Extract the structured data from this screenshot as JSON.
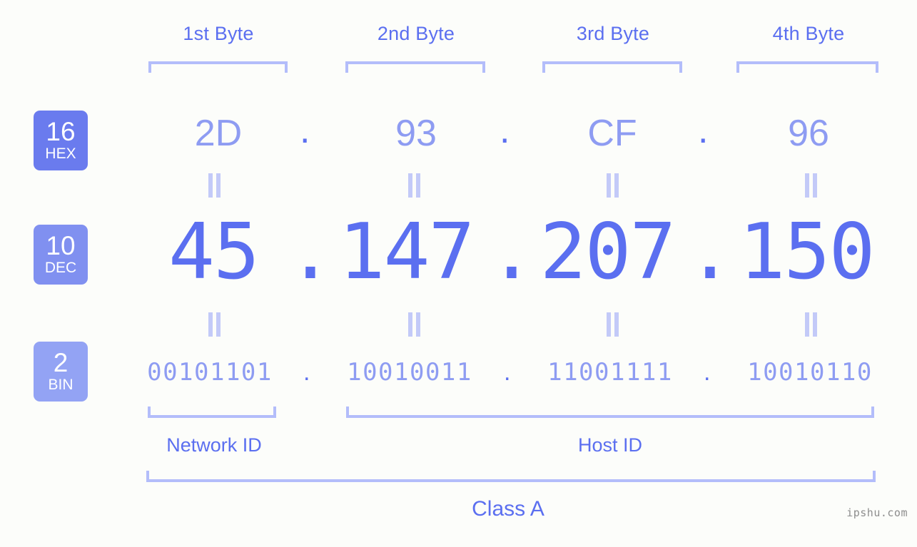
{
  "meta": {
    "background_color": "#fcfdfa",
    "accent_color": "#5b6ff0",
    "accent_light_color": "#8e9cf2",
    "bracket_color": "#b3bdfa",
    "watermark": "ipshu.com"
  },
  "byte_headers": [
    {
      "label": "1st Byte"
    },
    {
      "label": "2nd Byte"
    },
    {
      "label": "3rd Byte"
    },
    {
      "label": "4th Byte"
    }
  ],
  "bases": [
    {
      "number": "16",
      "unit": "HEX",
      "color": "#6a7bee"
    },
    {
      "number": "10",
      "unit": "DEC",
      "color": "#8090f0"
    },
    {
      "number": "2",
      "unit": "BIN",
      "color": "#93a3f4"
    }
  ],
  "rows": {
    "hex": {
      "name": "HEX",
      "values": [
        "2D",
        "93",
        "CF",
        "96"
      ],
      "separator": "."
    },
    "dec": {
      "name": "DEC",
      "values": [
        "45",
        "147",
        "207",
        "150"
      ],
      "separator": ".",
      "full": "45.147.207.150"
    },
    "bin": {
      "name": "BIN",
      "values": [
        "00101101",
        "10010011",
        "11001111",
        "10010110"
      ],
      "separator": "."
    }
  },
  "equals_symbol": "=",
  "id_sections": [
    {
      "label": "Network ID"
    },
    {
      "label": "Host ID"
    }
  ],
  "class": {
    "label": "Class A"
  }
}
